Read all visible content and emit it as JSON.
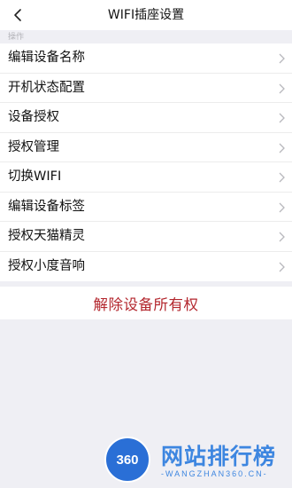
{
  "header": {
    "title": "WIFI插座设置"
  },
  "section": {
    "label": "操作"
  },
  "menu": {
    "items": [
      {
        "label": "编辑设备名称"
      },
      {
        "label": "开机状态配置"
      },
      {
        "label": "设备授权"
      },
      {
        "label": "授权管理"
      },
      {
        "label": "切换WIFI"
      },
      {
        "label": "编辑设备标签"
      },
      {
        "label": "授权天猫精灵"
      },
      {
        "label": "授权小度音响"
      }
    ]
  },
  "danger": {
    "label": "解除设备所有权",
    "color": "#b3262d"
  },
  "watermark": {
    "logo_text": "360",
    "brand": "网站排行榜",
    "url": "-WANGZHAN360.CN-"
  },
  "colors": {
    "background": "#efeff4",
    "accent": "#3d86e0"
  }
}
